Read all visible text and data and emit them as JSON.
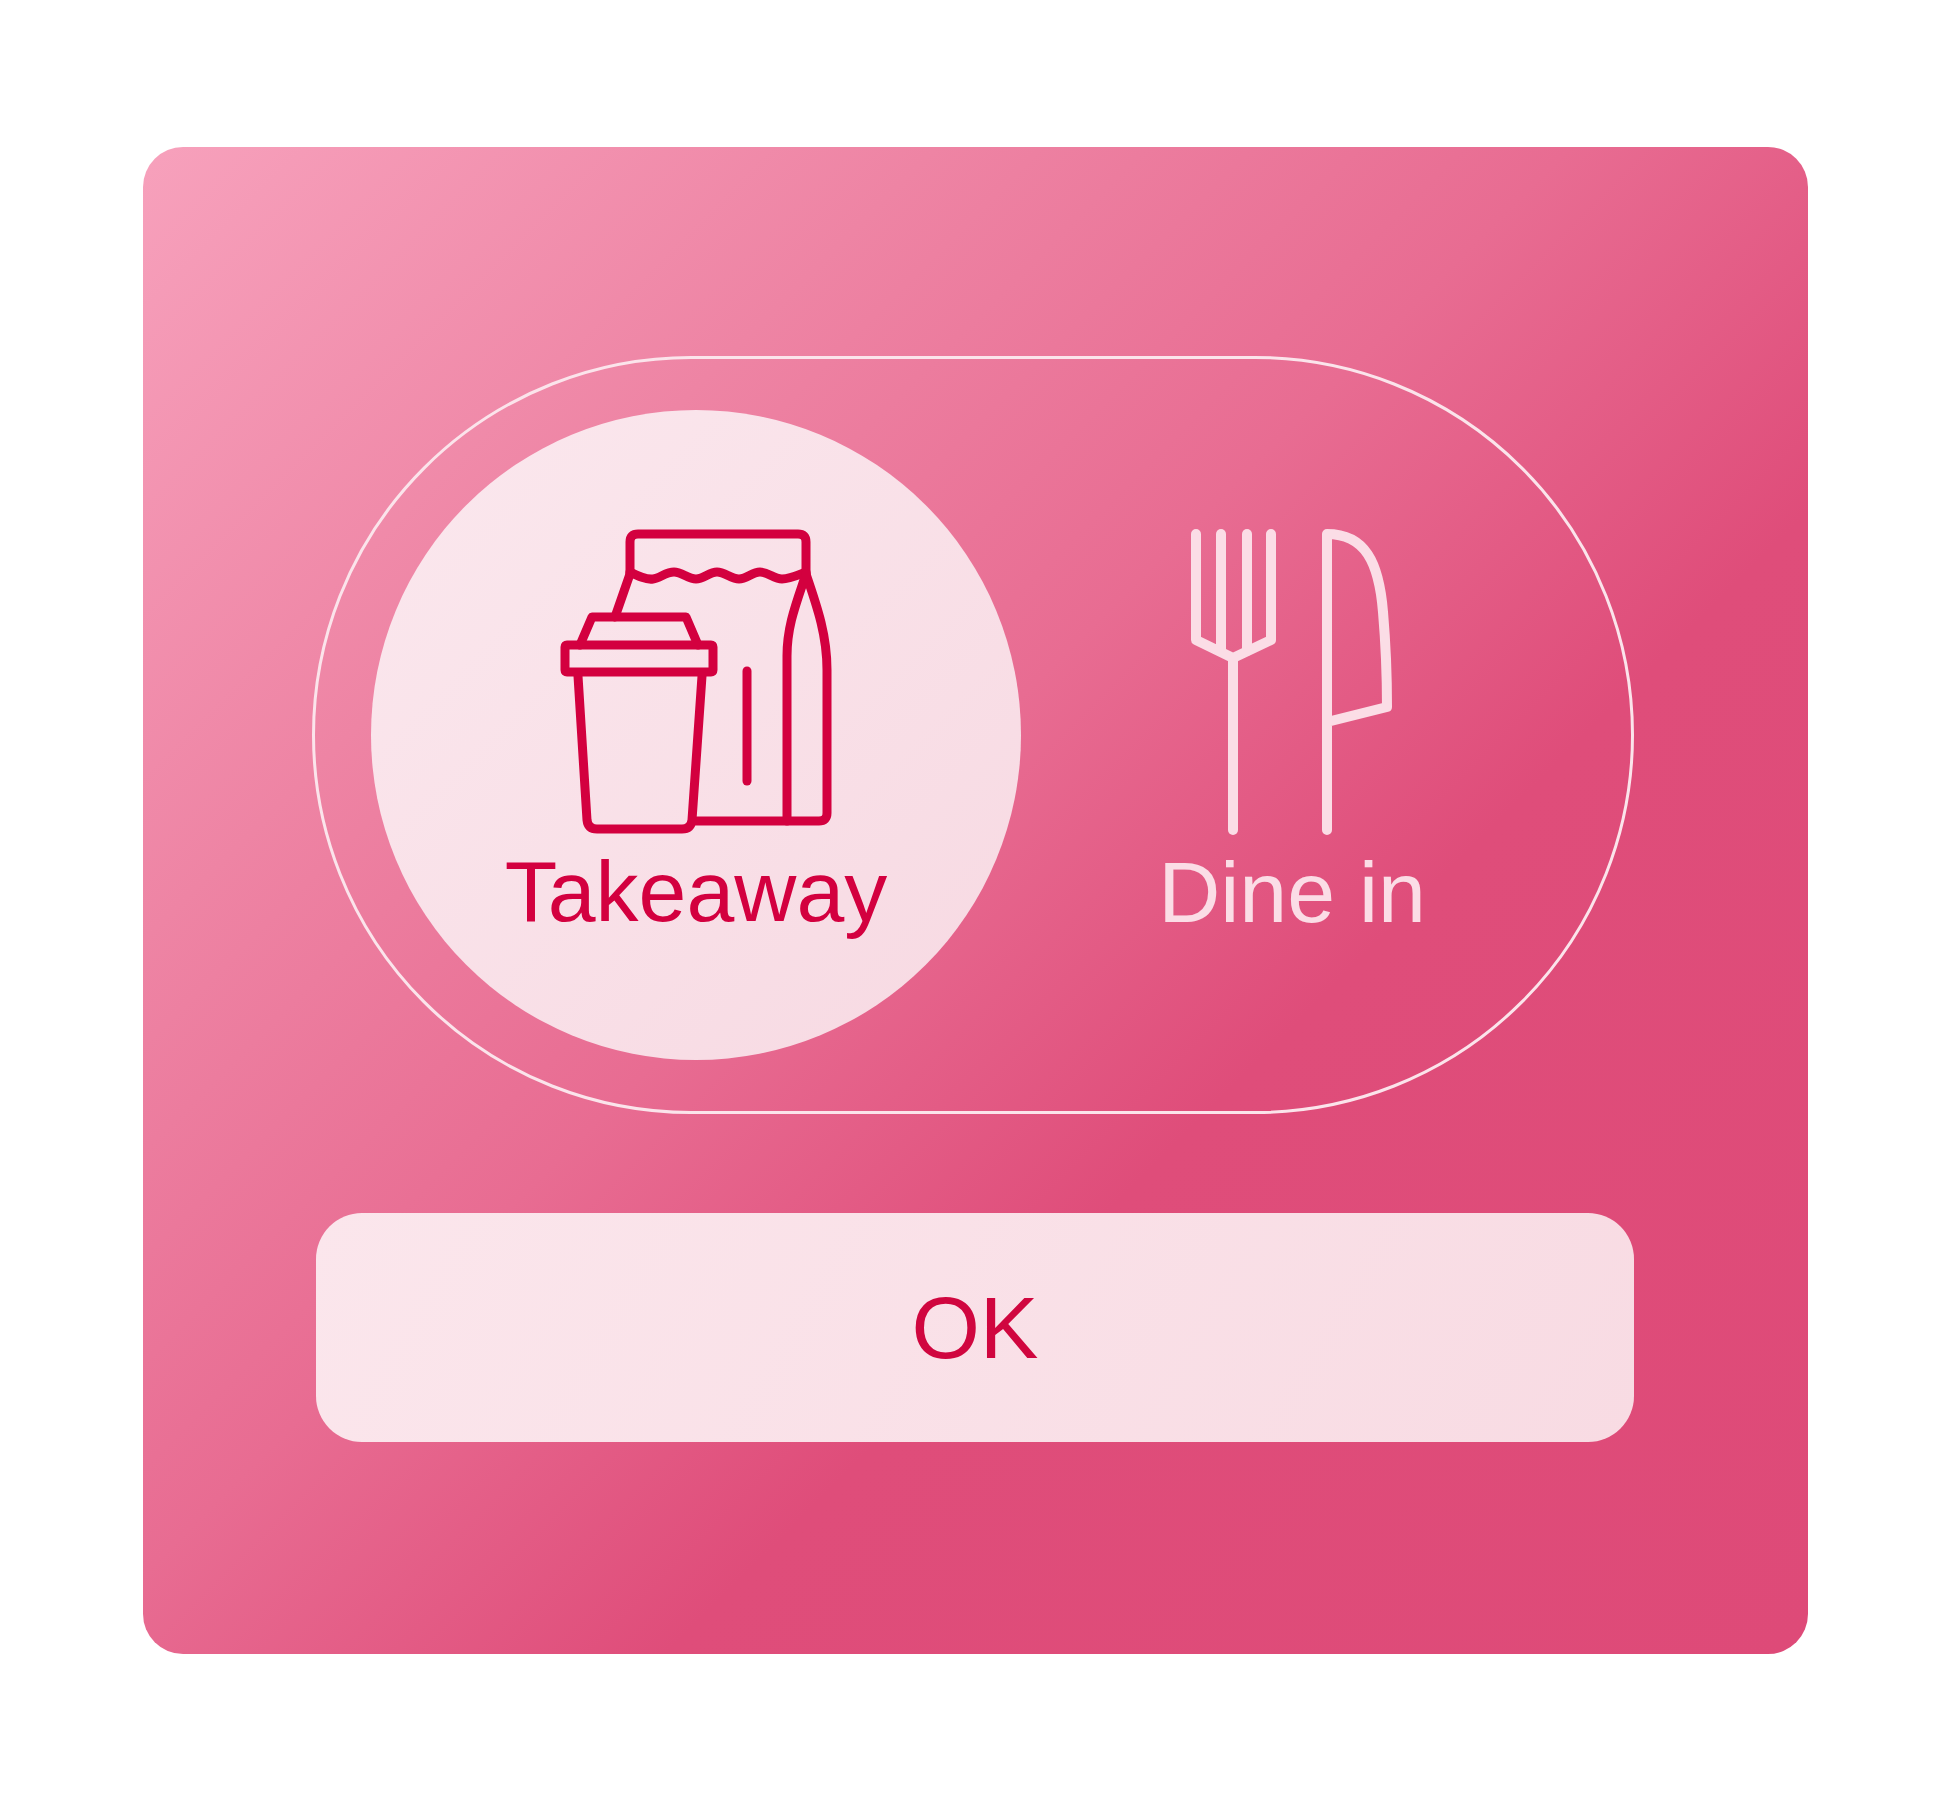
{
  "options": [
    {
      "kind": "takeaway",
      "label": "Takeaway",
      "selected": true
    },
    {
      "kind": "dine_in",
      "label": "Dine in",
      "selected": false
    }
  ],
  "ok_button": {
    "label": "OK"
  }
}
